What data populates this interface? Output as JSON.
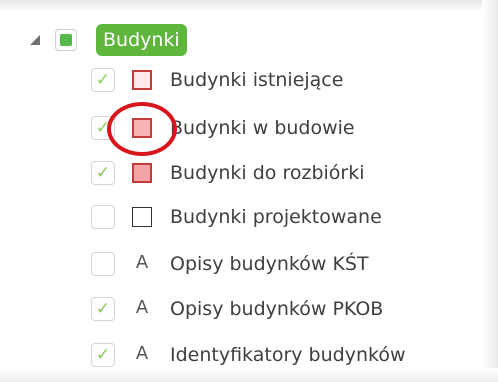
{
  "group": {
    "label": "Budynki",
    "expanded_icon": "triangle-expanded-icon",
    "checked_state": "partial",
    "accent_color": "#5fb63d"
  },
  "layers": [
    {
      "label": "Budynki istniejące",
      "checked": true,
      "check_mark": "✓",
      "symbol": "swatch",
      "fill": "#fde8ea",
      "stroke": "#c53b3b"
    },
    {
      "label": "Budynki w budowie",
      "checked": true,
      "check_mark": "✓",
      "symbol": "swatch",
      "fill": "#f7b3b6",
      "stroke": "#c53b3b",
      "highlighted": true
    },
    {
      "label": "Budynki do rozbiórki",
      "checked": true,
      "check_mark": "✓",
      "symbol": "swatch",
      "fill": "#f4a3a7",
      "stroke": "#c53b3b"
    },
    {
      "label": "Budynki projektowane",
      "checked": false,
      "check_mark": "",
      "symbol": "swatch",
      "fill": "#ffffff",
      "stroke": "#333333"
    },
    {
      "label": "Opisy budynków KŚT",
      "checked": false,
      "check_mark": "",
      "symbol": "text",
      "symbol_text": "A"
    },
    {
      "label": "Opisy budynków PKOB",
      "checked": true,
      "check_mark": "✓",
      "symbol": "text",
      "symbol_text": "A"
    },
    {
      "label": "Identyfikatory budynków",
      "checked": true,
      "check_mark": "✓",
      "symbol": "text",
      "symbol_text": "A"
    }
  ],
  "annotation": {
    "color": "#d8141c",
    "target": "Budynki w budowie"
  }
}
